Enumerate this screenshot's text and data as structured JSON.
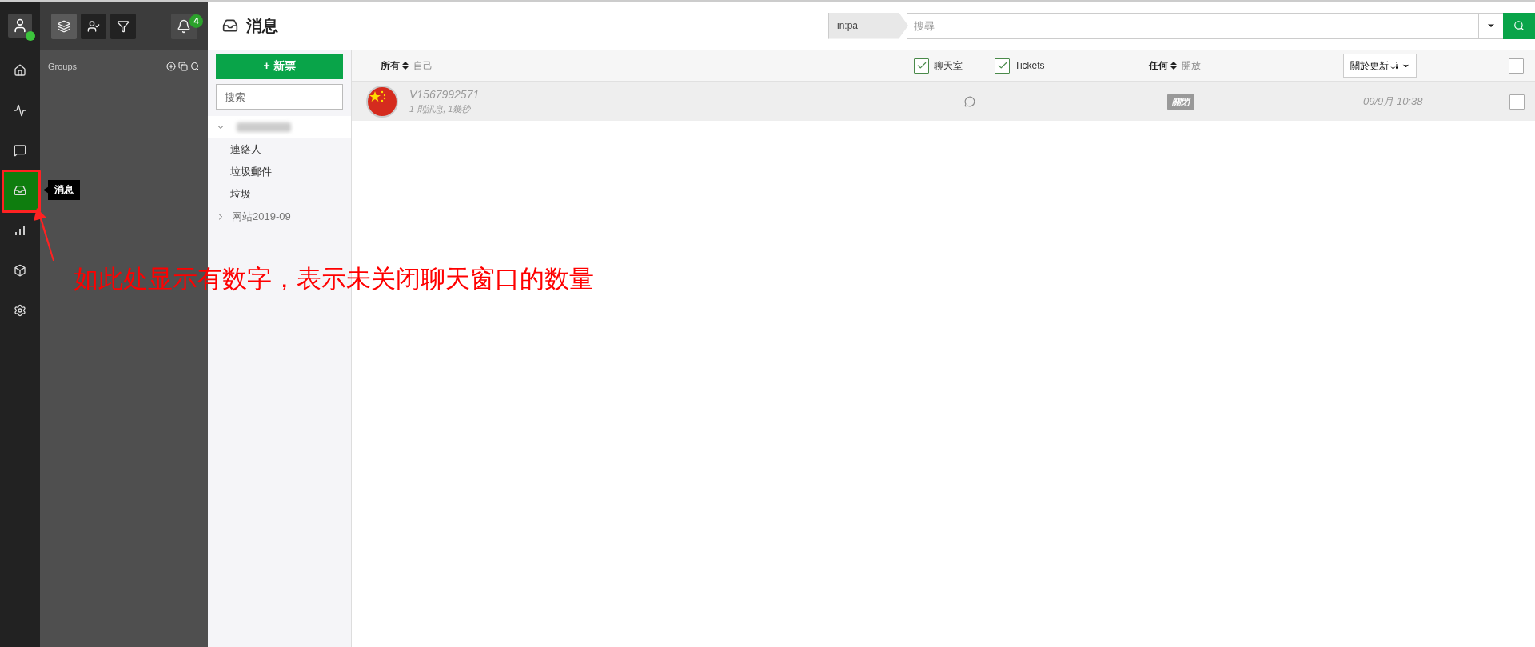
{
  "rail": {
    "items": [
      {
        "kind": "home",
        "selected": false
      },
      {
        "kind": "activity",
        "selected": false
      },
      {
        "kind": "chat",
        "selected": false
      },
      {
        "kind": "inbox",
        "selected": true
      },
      {
        "kind": "chart",
        "selected": false
      },
      {
        "kind": "box",
        "selected": false
      },
      {
        "kind": "settings",
        "selected": false
      }
    ],
    "tooltip": "消息"
  },
  "toolbar": {
    "buttons": [
      {
        "kind": "layers"
      },
      {
        "kind": "agents"
      },
      {
        "kind": "filter"
      }
    ],
    "notification_count": "4"
  },
  "groups": {
    "label": "Groups"
  },
  "page_title": "消息",
  "search": {
    "prefix": "in:pa",
    "placeholder": "搜尋"
  },
  "new_ticket": "+ 新票",
  "folder_search": {
    "placeholder": "搜索"
  },
  "tree": [
    {
      "kind": "redacted",
      "expanded": true,
      "children": [
        {
          "label": "連絡人"
        },
        {
          "label": "垃圾郵件"
        },
        {
          "label": "垃圾"
        }
      ]
    },
    {
      "kind": "folder",
      "label": "网站2019-09",
      "expanded": false
    }
  ],
  "filters": {
    "owner": "所有",
    "owner_option": "自己",
    "channels": [
      {
        "label": "聊天室",
        "checked": true
      },
      {
        "label": "Tickets",
        "checked": true
      }
    ],
    "status": "任何",
    "status_option": "開放",
    "sort": "關於更新",
    "select_all": false
  },
  "rows": [
    {
      "name": "V1567992571",
      "summary": "1 則訊息, 1幾秒",
      "status": "關閉",
      "time": "09/9月 10:38",
      "checked": false
    }
  ],
  "annotation": {
    "text": "如此处显示有数字，表示未关闭聊天窗口的数量"
  }
}
